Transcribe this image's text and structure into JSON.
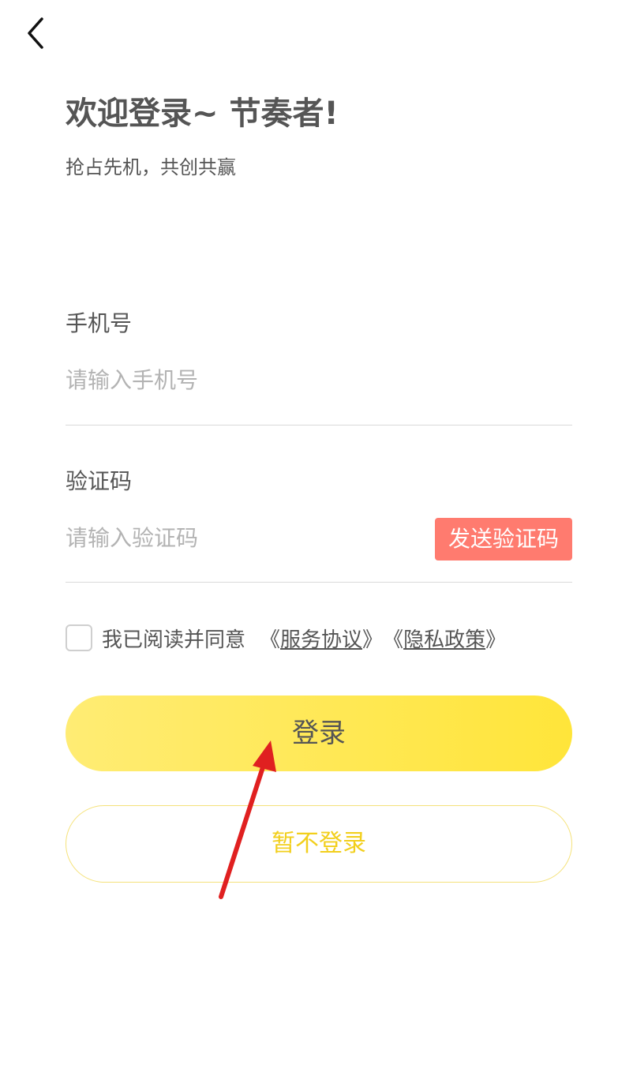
{
  "header": {
    "back_icon": "chevron-left-icon"
  },
  "welcome": {
    "title": "欢迎登录~ 节奏者!",
    "subtitle": "抢占先机，共创共赢"
  },
  "phone": {
    "label": "手机号",
    "placeholder": "请输入手机号",
    "value": ""
  },
  "code": {
    "label": "验证码",
    "placeholder": "请输入验证码",
    "value": "",
    "send_label": "发送验证码"
  },
  "agreement": {
    "text": "我已阅读并同意",
    "service_prefix": "《",
    "service_name": "服务协议",
    "service_suffix": "》",
    "privacy_prefix": "《",
    "privacy_name": "隐私政策",
    "privacy_suffix": "》",
    "checked": false
  },
  "actions": {
    "login_label": "登录",
    "skip_label": "暂不登录"
  },
  "colors": {
    "accent_yellow": "#ffe53a",
    "send_code_red": "#ff7b6f",
    "skip_text": "#f2cf1c",
    "annotation_arrow": "#e02020"
  }
}
